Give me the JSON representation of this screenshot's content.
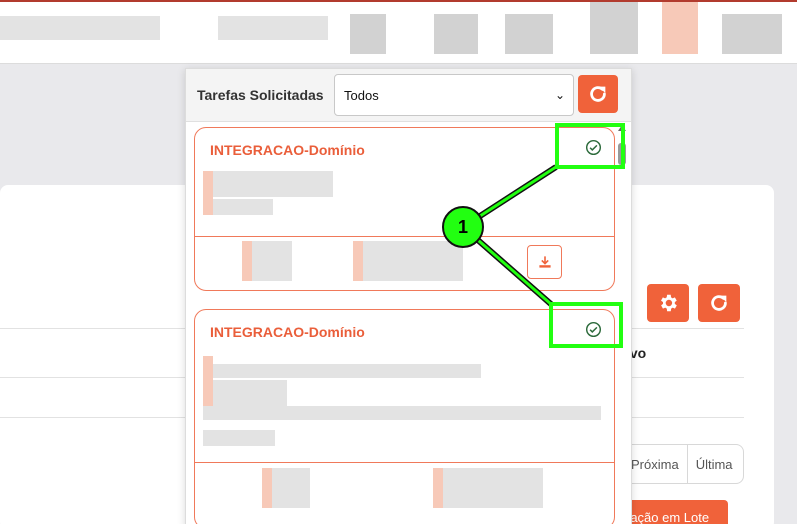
{
  "panel": {
    "title": "Tarefas Solicitadas",
    "filter_value": "Todos",
    "tasks": [
      {
        "title": "INTEGRACAO-Domínio",
        "status_icon": "check-circle-icon",
        "has_download": true
      },
      {
        "title": "INTEGRACAO-Domínio",
        "status_icon": "check-circle-icon",
        "has_download": false
      }
    ]
  },
  "background": {
    "column_header": "ivo",
    "pager": {
      "next": "Próxima",
      "last": "Última"
    },
    "batch_button": "ração em Lote"
  },
  "annotation": {
    "badge": "1",
    "color": "#22ff11"
  },
  "colors": {
    "accent": "#f0623a",
    "title": "#ea5e3a",
    "border": "#f0795a"
  }
}
